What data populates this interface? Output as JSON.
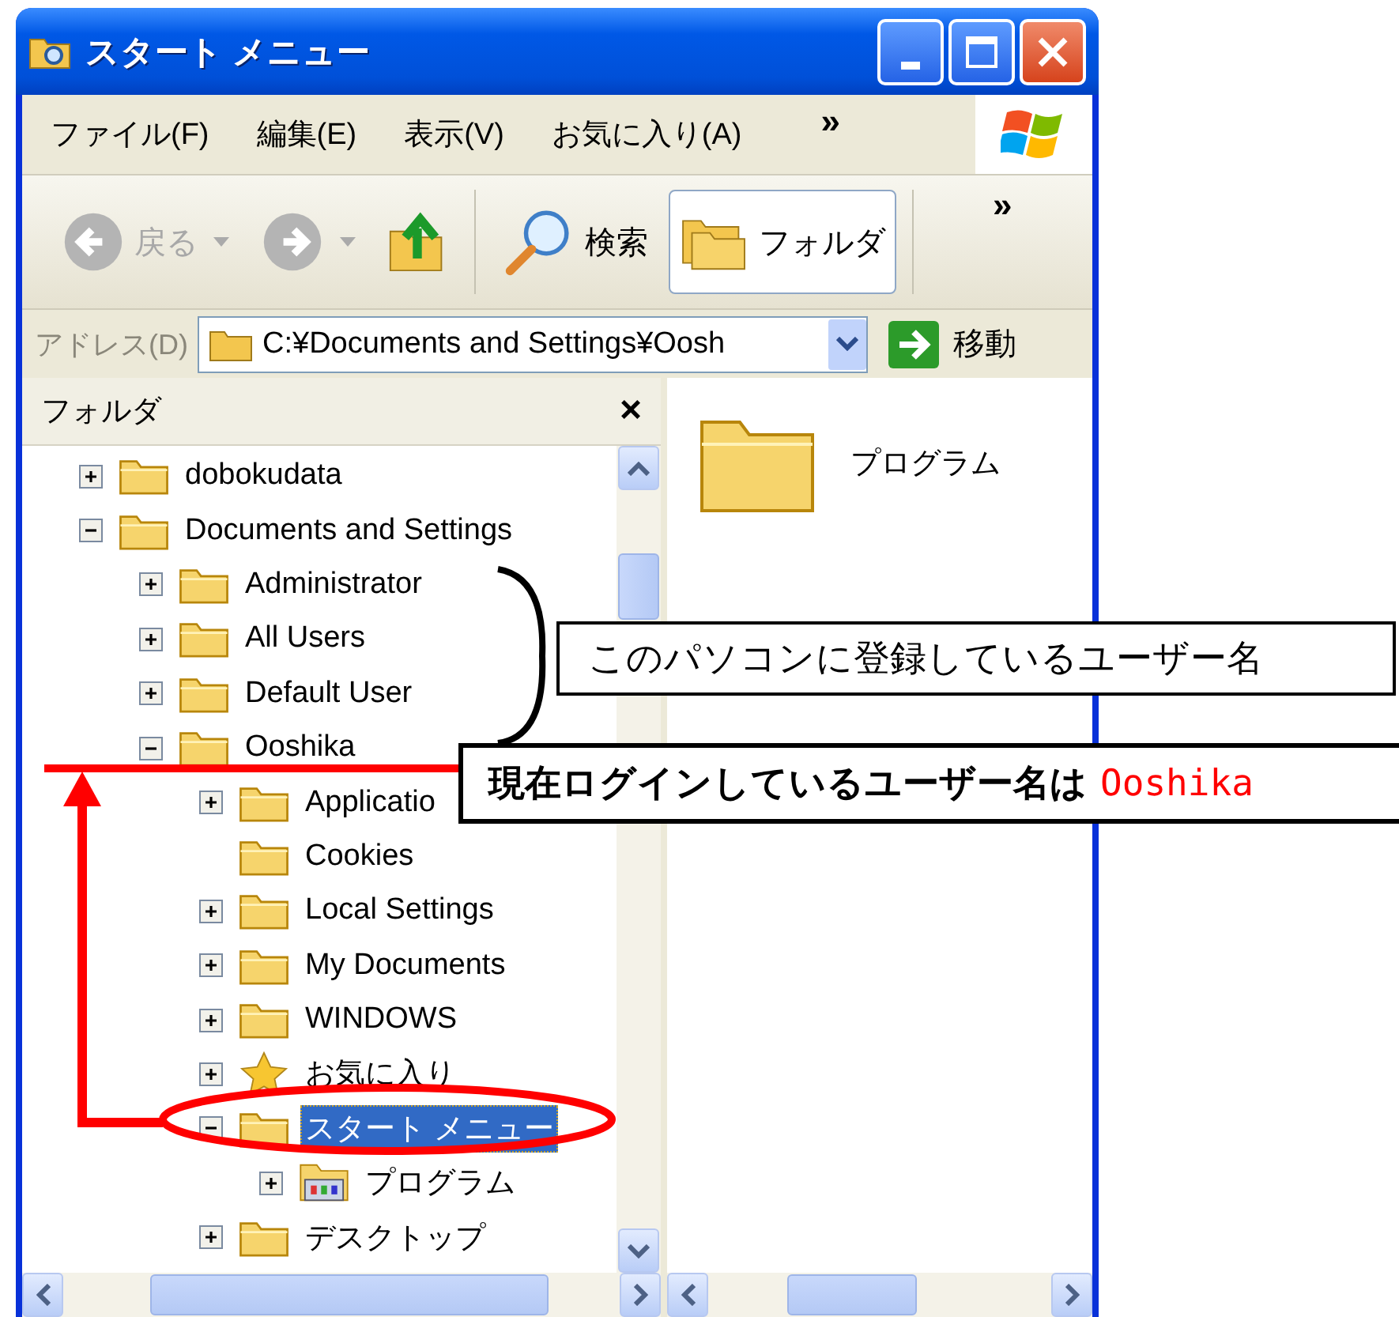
{
  "window": {
    "title": "スタート メニュー"
  },
  "menu_bar": {
    "items": [
      "ファイル(F)",
      "編集(E)",
      "表示(V)",
      "お気に入り(A)"
    ],
    "overflow": "»"
  },
  "toolbar": {
    "buttons": [
      {
        "kind": "back",
        "label": "戻る",
        "disabled": true,
        "selected": false
      },
      {
        "kind": "forward",
        "disabled": true,
        "selected": false
      },
      {
        "kind": "up",
        "disabled": false,
        "selected": false
      },
      {
        "kind": "search",
        "label": "検索",
        "disabled": false,
        "selected": false
      },
      {
        "kind": "folders",
        "label": "フォルダ",
        "disabled": false,
        "selected": true
      }
    ],
    "overflow": "»"
  },
  "address_bar": {
    "label": "アドレス(D)",
    "value": "C:¥Documents and Settings¥Oosh",
    "go_label": "移動"
  },
  "folders_pane": {
    "title": "フォルダ",
    "close": "×",
    "tree": [
      {
        "label": "dobokudata",
        "kind": "folder",
        "expandable": true,
        "expanded": false,
        "selected": false
      },
      {
        "label": "Documents and Settings",
        "kind": "folder",
        "expandable": true,
        "expanded": true,
        "selected": false,
        "children": [
          {
            "label": "Administrator",
            "kind": "folder",
            "expandable": true,
            "expanded": false,
            "selected": false
          },
          {
            "label": "All Users",
            "kind": "folder",
            "expandable": true,
            "expanded": false,
            "selected": false
          },
          {
            "label": "Default User",
            "kind": "folder",
            "expandable": true,
            "expanded": false,
            "selected": false
          },
          {
            "label": "Ooshika",
            "kind": "folder",
            "expandable": true,
            "expanded": true,
            "selected": false,
            "children": [
              {
                "label": "Applicatio",
                "kind": "folder",
                "expandable": true,
                "expanded": false,
                "selected": false
              },
              {
                "label": "Cookies",
                "kind": "folder",
                "expandable": false,
                "selected": false
              },
              {
                "label": "Local Settings",
                "kind": "folder",
                "expandable": true,
                "expanded": false,
                "selected": false
              },
              {
                "label": "My Documents",
                "kind": "folder",
                "expandable": true,
                "expanded": false,
                "selected": false
              },
              {
                "label": "WINDOWS",
                "kind": "folder",
                "expandable": true,
                "expanded": false,
                "selected": false
              },
              {
                "label": "お気に入り",
                "kind": "favorites",
                "expandable": true,
                "expanded": false,
                "selected": false
              },
              {
                "label": "スタート メニュー",
                "kind": "folder",
                "expandable": true,
                "expanded": true,
                "selected": true,
                "children": [
                  {
                    "label": "プログラム",
                    "kind": "programs",
                    "expandable": true,
                    "expanded": false,
                    "selected": false
                  }
                ]
              },
              {
                "label": "デスクトップ",
                "kind": "folder",
                "expandable": true,
                "expanded": false,
                "selected": false
              }
            ]
          }
        ]
      }
    ]
  },
  "contents": {
    "items": [
      {
        "name": "プログラム"
      }
    ]
  },
  "annotations": {
    "users_note": "このパソコンに登録しているユーザー名",
    "login_note": {
      "text": "現在ログインしているユーザー名は",
      "user": "Ooshika"
    }
  }
}
